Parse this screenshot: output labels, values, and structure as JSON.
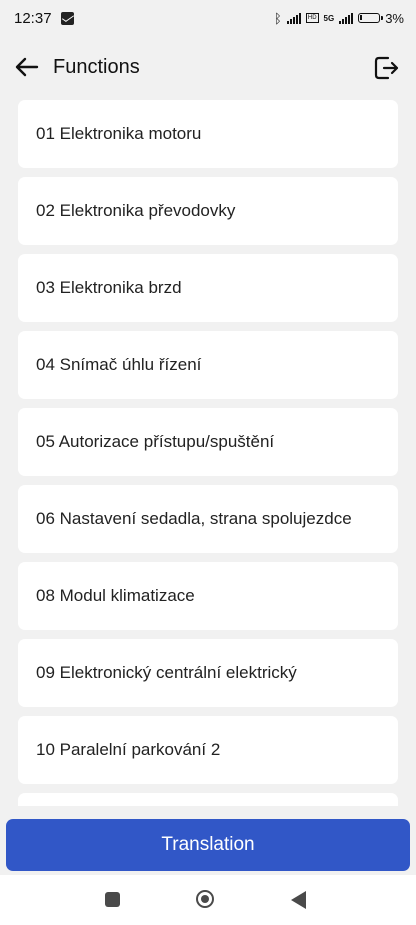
{
  "status": {
    "time": "12:37",
    "network": "5G",
    "battery": "3%"
  },
  "header": {
    "title": "Functions"
  },
  "functions": [
    "01 Elektronika motoru",
    "02 Elektronika převodovky",
    "03 Elektronika brzd",
    "04 Snímač úhlu řízení",
    "05 Autorizace přístupu/spuštění",
    "06 Nastavení sedadla, strana spolujezdce",
    "08 Modul klimatizace",
    "09 Elektronický centrální elektrický",
    "10 Paralelní parkování 2",
    ""
  ],
  "footer": {
    "button_label": "Translation"
  },
  "colors": {
    "accent": "#3157c7",
    "background": "#f1f1f1",
    "card": "#ffffff"
  }
}
